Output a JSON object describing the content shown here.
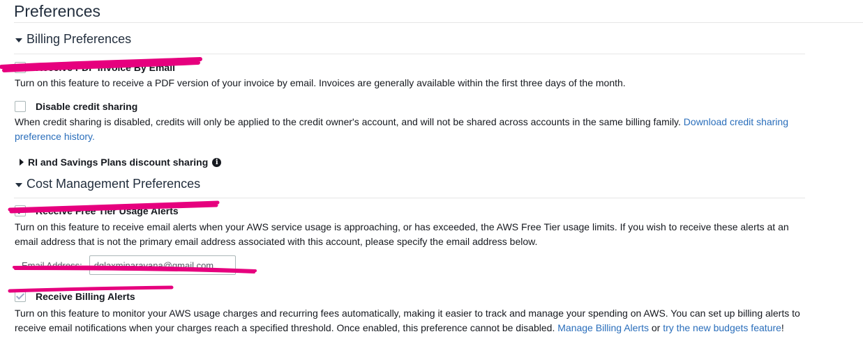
{
  "page_title": "Preferences",
  "billing": {
    "heading": "Billing Preferences",
    "pdf_invoice_label": "Receive PDF Invoice By Email",
    "pdf_invoice_checked": true,
    "pdf_invoice_desc": "Turn on this feature to receive a PDF version of your invoice by email. Invoices are generally available within the first three days of the month.",
    "credit_label": "Disable credit sharing",
    "credit_checked": false,
    "credit_desc": "When credit sharing is disabled, credits will only be applied to the credit owner's account, and will not be shared across accounts in the same billing family.",
    "credit_link": "Download credit sharing preference history.",
    "ri_label": "RI and Savings Plans discount sharing",
    "ri_info_icon": "info-icon"
  },
  "cost": {
    "heading": "Cost Management Preferences",
    "free_tier_label": "Receive Free Tier Usage Alerts",
    "free_tier_checked": true,
    "free_tier_desc": "Turn on this feature to receive email alerts when your AWS service usage is approaching, or has exceeded, the AWS Free Tier usage limits. If you wish to receive these alerts at an email address that is not the primary email address associated with this account, please specify the email address below.",
    "email_label": "Email Address:",
    "email_value": "dglaxminarayana@gmail.com",
    "billing_alerts_label": "Receive Billing Alerts",
    "billing_alerts_checked": true,
    "billing_alerts_desc": "Turn on this feature to monitor your AWS usage charges and recurring fees automatically, making it easier to track and manage your spending on AWS. You can set up billing alerts to receive email notifications when your charges reach a specified threshold. Once enabled, this preference cannot be disabled.",
    "manage_link": "Manage Billing Alerts",
    "or_text": "or",
    "budgets_link": "try the new budgets feature",
    "exclaim": "!"
  },
  "colors": {
    "link": "#2a6ebb",
    "annotation": "#e6007e"
  }
}
